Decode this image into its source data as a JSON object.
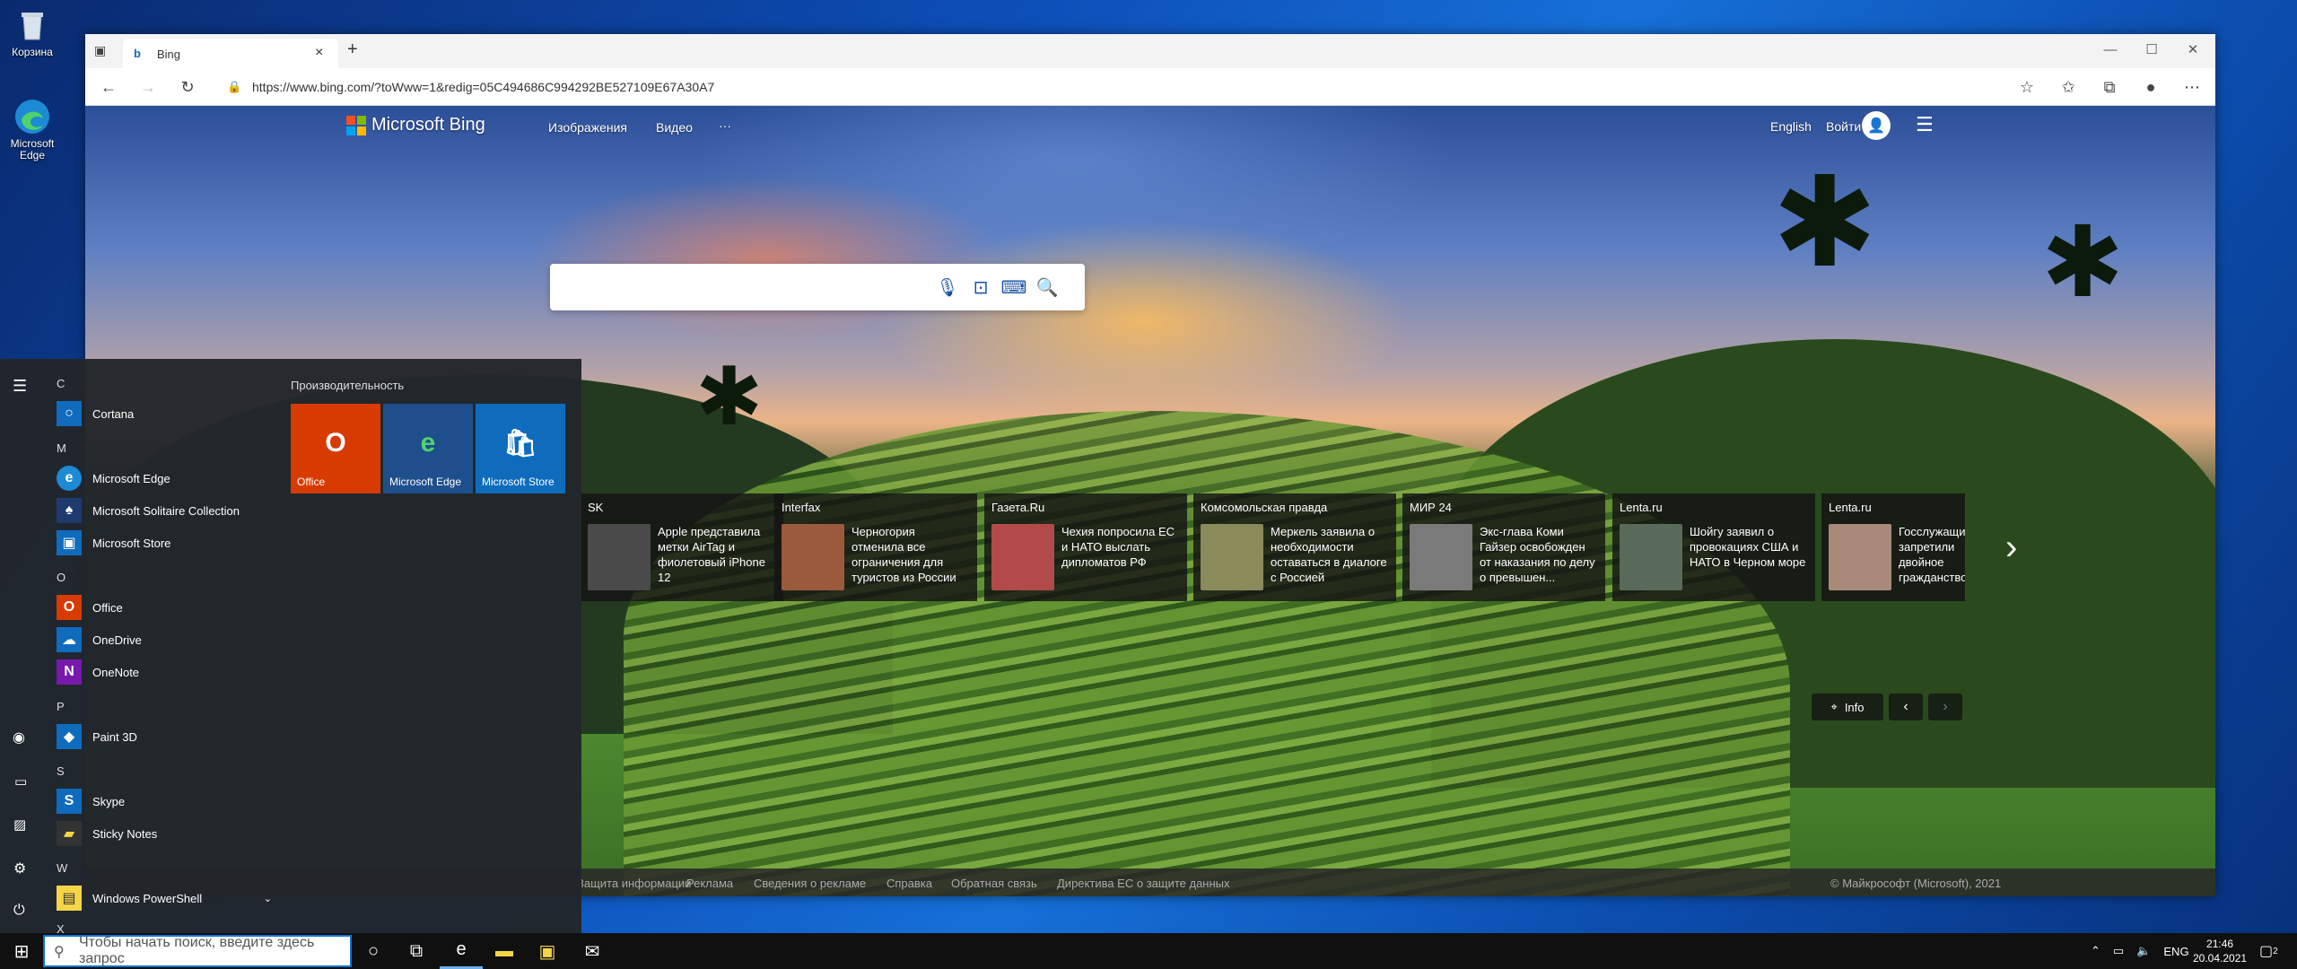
{
  "desktop": {
    "recycle_label": "Корзина",
    "edge_label": "Microsoft Edge"
  },
  "browser": {
    "tab_title": "Bing",
    "url": "https://www.bing.com/?toWww=1&redig=05C494686C994292BE527109E67A30A7",
    "new_tab": "+",
    "tab_close": "×"
  },
  "bing": {
    "logo": "Microsoft Bing",
    "nav": [
      "Изображения",
      "Видео",
      "···"
    ],
    "lang": "English",
    "signin": "Войти",
    "info": "Info",
    "news": [
      {
        "source": "SK",
        "text": "Apple представила метки AirTag и фиолетовый iPhone 12"
      },
      {
        "source": "Interfax",
        "text": "Черногория отменила все ограничения для туристов из России"
      },
      {
        "source": "Газета.Ru",
        "text": "Чехия попросила ЕС и НАТО выслать дипломатов РФ"
      },
      {
        "source": "Комсомольская правда",
        "text": "Меркель заявила о необходимости оставаться в диалоге с Россией"
      },
      {
        "source": "МИР 24",
        "text": "Экс-глава Коми Гайзер освобожден от наказания по делу о превышен..."
      },
      {
        "source": "Lenta.ru",
        "text": "Шойгу заявил о провокациях США и НАТО в Черном море"
      },
      {
        "source": "Lenta.ru",
        "text": "Госслужащим запретили двойное гражданство"
      }
    ],
    "footer_links": [
      "Защита информации",
      "Реклама",
      "Сведения о рекламе",
      "Справка",
      "Обратная связь",
      "Директива ЕС о защите данных"
    ],
    "copyright": "© Майкрософт (Microsoft), 2021"
  },
  "start": {
    "groups": [
      {
        "letter": "C",
        "apps": [
          "Cortana"
        ]
      },
      {
        "letter": "M",
        "apps": [
          "Microsoft Edge",
          "Microsoft Solitaire Collection",
          "Microsoft Store"
        ]
      },
      {
        "letter": "O",
        "apps": [
          "Office",
          "OneDrive",
          "OneNote"
        ]
      },
      {
        "letter": "P",
        "apps": [
          "Paint 3D"
        ]
      },
      {
        "letter": "S",
        "apps": [
          "Skype",
          "Sticky Notes"
        ]
      },
      {
        "letter": "W",
        "apps": [
          "Windows PowerShell"
        ]
      },
      {
        "letter": "X",
        "apps": []
      }
    ],
    "tiles_group": "Производительность",
    "tiles": [
      {
        "label": "Office",
        "color": "#d83b01",
        "icon": "office-icon"
      },
      {
        "label": "Microsoft Edge",
        "color": "#1f4e8c",
        "icon": "edge-icon"
      },
      {
        "label": "Microsoft Store",
        "color": "#0f6cbd",
        "icon": "store-icon"
      }
    ]
  },
  "taskbar": {
    "search_placeholder": "Чтобы начать поиск, введите здесь запрос",
    "lang": "ENG",
    "time": "21:46",
    "date": "20.04.2021",
    "notification_count": "2"
  }
}
